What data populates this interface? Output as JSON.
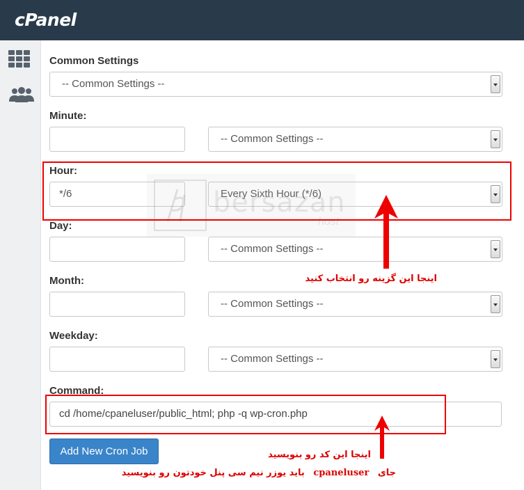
{
  "app": {
    "logo": "cPanel"
  },
  "sidebar": {
    "icons": [
      "grid-icon",
      "users-icon"
    ]
  },
  "form": {
    "common": {
      "label": "Common Settings",
      "value": "-- Common Settings --"
    },
    "minute": {
      "label": "Minute:",
      "value": "",
      "select": "-- Common Settings --"
    },
    "hour": {
      "label": "Hour:",
      "value": "*/6",
      "select": "Every Sixth Hour (*/6)"
    },
    "day": {
      "label": "Day:",
      "value": "",
      "select": "-- Common Settings --"
    },
    "month": {
      "label": "Month:",
      "value": "",
      "select": "-- Common Settings --"
    },
    "weekday": {
      "label": "Weekday:",
      "value": "",
      "select": "-- Common Settings --"
    },
    "command": {
      "label": "Command:",
      "value": "cd /home/cpaneluser/public_html; php -q wp-cron.php"
    },
    "submit_label": "Add New Cron Job"
  },
  "watermark": {
    "text": "bersazan",
    "sub": "host"
  },
  "annotations": {
    "hour_note": "اینجا این گزینه رو انتخاب کنید",
    "command_note": "اینجا این کد رو بنویسید",
    "user_note_right": "جای",
    "user_note_mid": "cpaneluser",
    "user_note_left": "باید یوزر نیم سی پنل خودتون رو بنویسید"
  },
  "colors": {
    "topbar": "#293a4a",
    "button": "#3a84c9",
    "annotation": "#dd0000"
  }
}
